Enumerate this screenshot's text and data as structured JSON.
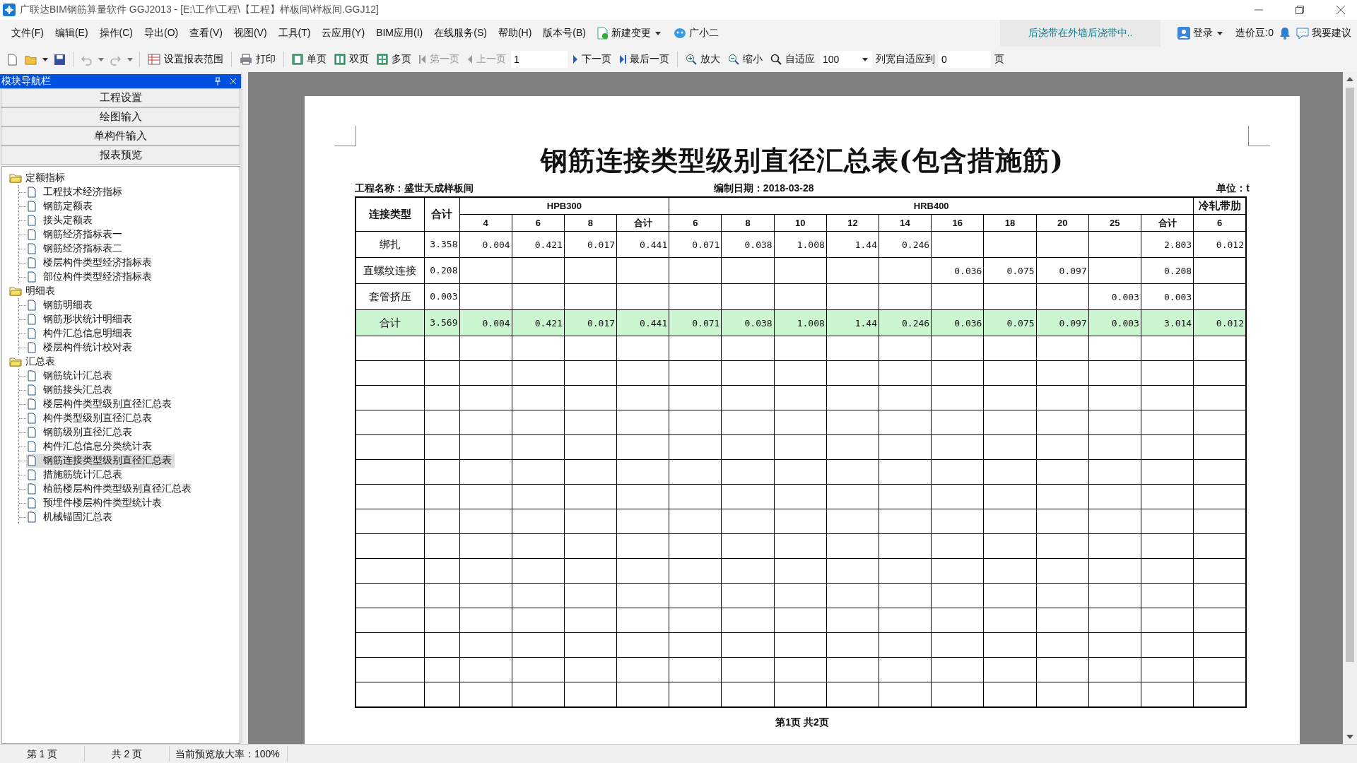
{
  "window": {
    "title": "广联达BIM钢筋算量软件 GGJ2013 - [E:\\工作\\工程\\【工程】样板间\\样板间.GGJ12]"
  },
  "menu": [
    "文件(F)",
    "编辑(E)",
    "操作(C)",
    "导出(O)",
    "查看(V)",
    "视图(V)",
    "工具(T)",
    "云应用(Y)",
    "BIM应用(I)",
    "在线服务(S)",
    "帮助(H)",
    "版本号(B)"
  ],
  "menu_extras": {
    "new_change": "新建变更",
    "assistant": "广小二",
    "notice": "后浇带在外墙后浇带中..",
    "login": "登录",
    "beans": "造价豆:0",
    "suggest": "我要建议"
  },
  "toolbar": {
    "undo_disabled": true,
    "redo_disabled": true,
    "set_range": "设置报表范围",
    "print": "打印",
    "single": "单页",
    "double": "双页",
    "multi": "多页",
    "first": {
      "label": "第一页",
      "disabled": true
    },
    "prev": {
      "label": "上一页",
      "disabled": true
    },
    "page_field": "1",
    "next": {
      "label": "下一页",
      "disabled": false
    },
    "last": {
      "label": "最后一页",
      "disabled": false
    },
    "zoom_in": "放大",
    "zoom_out": "缩小",
    "fit": "自适应",
    "zoom_value": "100",
    "fit_columns": "列宽自适应到",
    "fit_columns_value": "0",
    "pages_unit": "页"
  },
  "sidebar": {
    "title": "模块导航栏",
    "modules": [
      "工程设置",
      "绘图输入",
      "单构件输入",
      "报表预览"
    ],
    "tree": [
      {
        "label": "定额指标",
        "expanded": true,
        "children": [
          {
            "label": "工程技术经济指标",
            "selected": false
          },
          {
            "label": "钢筋定额表",
            "selected": false
          },
          {
            "label": "接头定额表",
            "selected": false
          },
          {
            "label": "钢筋经济指标表一",
            "selected": false
          },
          {
            "label": "钢筋经济指标表二",
            "selected": false
          },
          {
            "label": "楼层构件类型经济指标表",
            "selected": false
          },
          {
            "label": "部位构件类型经济指标表",
            "selected": false
          }
        ]
      },
      {
        "label": "明细表",
        "expanded": true,
        "children": [
          {
            "label": "钢筋明细表",
            "selected": false
          },
          {
            "label": "钢筋形状统计明细表",
            "selected": false
          },
          {
            "label": "构件汇总信息明细表",
            "selected": false
          },
          {
            "label": "楼层构件统计校对表",
            "selected": false
          }
        ]
      },
      {
        "label": "汇总表",
        "expanded": true,
        "children": [
          {
            "label": "钢筋统计汇总表",
            "selected": false
          },
          {
            "label": "钢筋接头汇总表",
            "selected": false
          },
          {
            "label": "楼层构件类型级别直径汇总表",
            "selected": false
          },
          {
            "label": "构件类型级别直径汇总表",
            "selected": false
          },
          {
            "label": "钢筋级别直径汇总表",
            "selected": false
          },
          {
            "label": "构件汇总信息分类统计表",
            "selected": false
          },
          {
            "label": "钢筋连接类型级别直径汇总表",
            "selected": true
          },
          {
            "label": "措施筋统计汇总表",
            "selected": false
          },
          {
            "label": "植筋楼层构件类型级别直径汇总表",
            "selected": false
          },
          {
            "label": "预埋件楼层构件类型统计表",
            "selected": false
          },
          {
            "label": "机械锚固汇总表",
            "selected": false
          }
        ]
      }
    ]
  },
  "report": {
    "title": "钢筋连接类型级别直径汇总表(包含措施筋)",
    "project": "工程名称：盛世天成样板间",
    "date": "编制日期：2018-03-28",
    "unit": "单位：t",
    "head_type": "连接类型",
    "head_total": "合计",
    "groups": [
      {
        "name": "HPB300",
        "sizes": [
          "4",
          "6",
          "8",
          "合计"
        ]
      },
      {
        "name": "HRB400",
        "sizes": [
          "6",
          "8",
          "10",
          "12",
          "14",
          "16",
          "18",
          "20",
          "25",
          "合计"
        ]
      },
      {
        "name": "冷轧带肋",
        "sizes": [
          "6"
        ]
      }
    ],
    "rows": [
      {
        "kind": "data",
        "label": "绑扎",
        "total": "3.358",
        "cells": [
          "0.004",
          "0.421",
          "0.017",
          "0.441",
          "0.071",
          "0.038",
          "1.008",
          "1.44",
          "0.246",
          null,
          null,
          null,
          null,
          "2.803",
          "0.012"
        ]
      },
      {
        "kind": "data",
        "label": "直螺纹连接",
        "total": "0.208",
        "cells": [
          null,
          null,
          null,
          null,
          null,
          null,
          null,
          null,
          null,
          "0.036",
          "0.075",
          "0.097",
          null,
          "0.208",
          null
        ]
      },
      {
        "kind": "data",
        "label": "套管挤压",
        "total": "0.003",
        "cells": [
          null,
          null,
          null,
          null,
          null,
          null,
          null,
          null,
          null,
          null,
          null,
          null,
          "0.003",
          "0.003",
          null
        ]
      },
      {
        "kind": "total",
        "label": "合计",
        "total": "3.569",
        "cells": [
          "0.004",
          "0.421",
          "0.017",
          "0.441",
          "0.071",
          "0.038",
          "1.008",
          "1.44",
          "0.246",
          "0.036",
          "0.075",
          "0.097",
          "0.003",
          "3.014",
          "0.012"
        ]
      }
    ],
    "footer": "第1页 共2页"
  },
  "status_bar": {
    "page": "第 1 页",
    "pages": "共 2 页",
    "zoom": "当前预览放大率：100%"
  }
}
